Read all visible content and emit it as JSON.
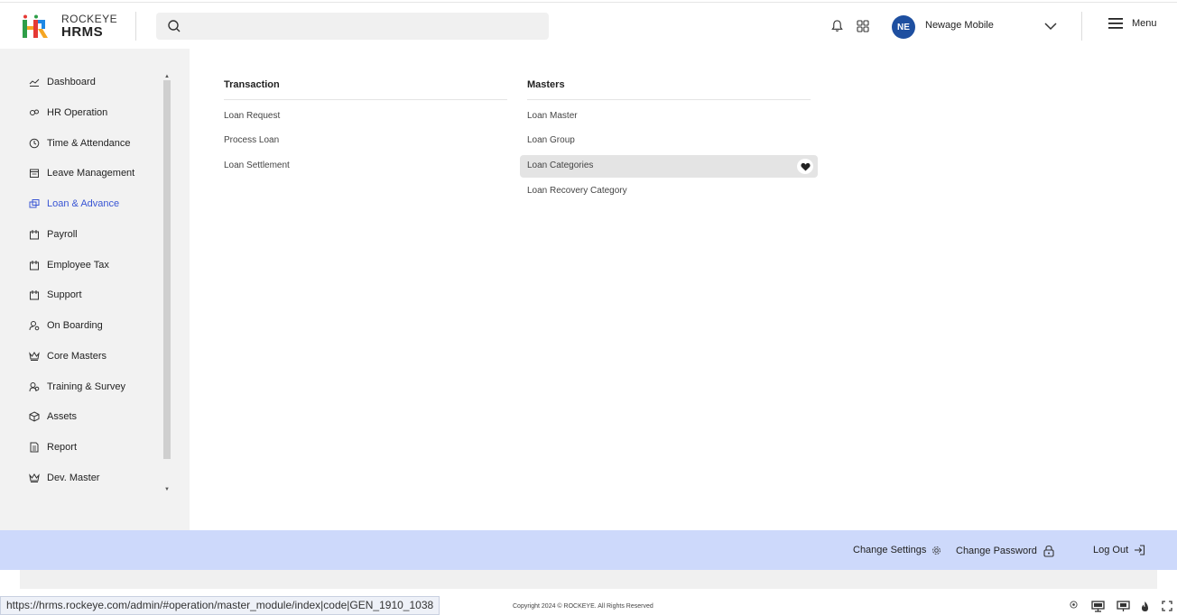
{
  "header": {
    "brand_top": "ROCKEYE",
    "brand_bottom": "HRMS",
    "search_placeholder": "",
    "avatar_initials": "NE",
    "user_name": "Newage Mobile",
    "menu_label": "Menu"
  },
  "sidebar": {
    "items": [
      {
        "label": "Dashboard",
        "icon": "chart-line-icon"
      },
      {
        "label": "HR Operation",
        "icon": "gears-icon"
      },
      {
        "label": "Time & Attendance",
        "icon": "clock-icon"
      },
      {
        "label": "Leave Management",
        "icon": "calendar-icon"
      },
      {
        "label": "Loan & Advance",
        "icon": "loan-icon"
      },
      {
        "label": "Payroll",
        "icon": "payroll-icon"
      },
      {
        "label": "Employee Tax",
        "icon": "tax-icon"
      },
      {
        "label": "Support",
        "icon": "support-icon"
      },
      {
        "label": "On Boarding",
        "icon": "user-gear-icon"
      },
      {
        "label": "Core Masters",
        "icon": "crown-icon"
      },
      {
        "label": "Training & Survey",
        "icon": "users-icon"
      },
      {
        "label": "Assets",
        "icon": "cube-icon"
      },
      {
        "label": "Report",
        "icon": "document-icon"
      },
      {
        "label": "Dev. Master",
        "icon": "crown-icon"
      }
    ],
    "active_index": 4
  },
  "main": {
    "transaction": {
      "title": "Transaction",
      "links": [
        "Loan Request",
        "Process Loan",
        "Loan Settlement"
      ]
    },
    "masters": {
      "title": "Masters",
      "links": [
        "Loan Master",
        "Loan Group",
        "Loan Categories",
        "Loan Recovery Category"
      ],
      "highlighted_index": 2
    }
  },
  "footer": {
    "change_settings": "Change Settings",
    "change_password": "Change Password",
    "log_out": "Log Out",
    "copyright": "Copyright 2024 © ROCKEYE. All Rights Reserved"
  },
  "status": {
    "url": "https://hrms.rockeye.com/admin/#operation/master_module/index|code|GEN_1910_1038"
  },
  "colors": {
    "accent": "#3955d4",
    "avatar_bg": "#1e4fa0",
    "footer_bg": "#cdd9fb",
    "sidebar_bg": "#f2f2f2"
  }
}
